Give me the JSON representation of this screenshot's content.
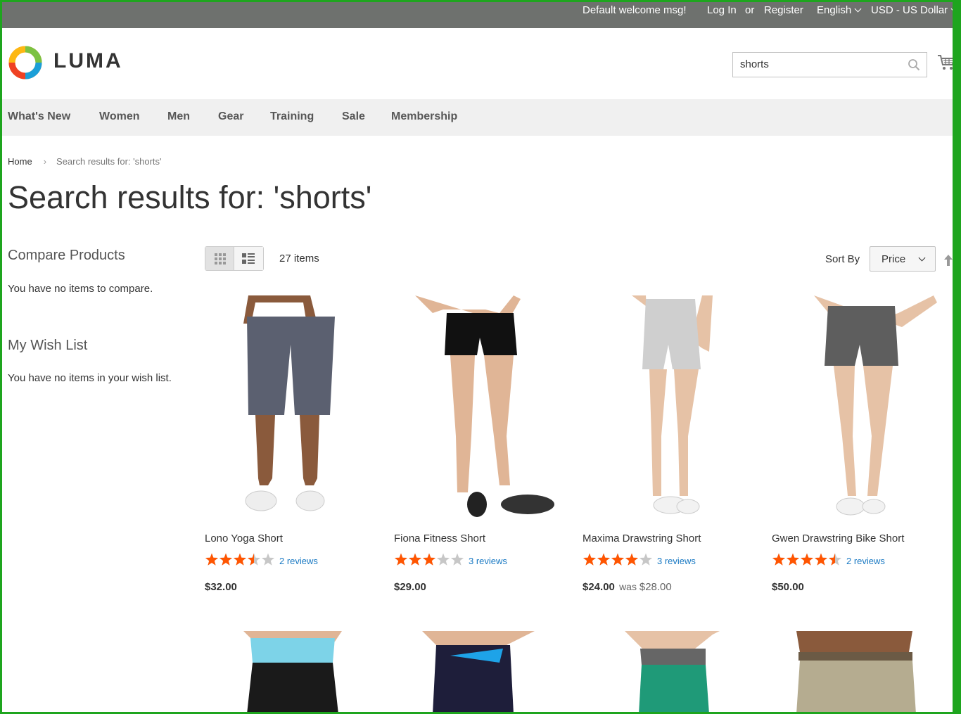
{
  "topbar": {
    "welcome": "Default welcome msg!",
    "login": "Log In",
    "or": "or",
    "register": "Register",
    "language": "English",
    "currency": "USD - US Dollar"
  },
  "header": {
    "logo_text": "LUMA",
    "search_value": "shorts"
  },
  "nav": {
    "items": [
      "What's New",
      "Women",
      "Men",
      "Gear",
      "Training",
      "Sale",
      "Membership"
    ]
  },
  "breadcrumb": {
    "home": "Home",
    "current": "Search results for: 'shorts'"
  },
  "page": {
    "title": "Search results for: 'shorts'"
  },
  "sidebar": {
    "compare_title": "Compare Products",
    "compare_text": "You have no items to compare.",
    "wishlist_title": "My Wish List",
    "wishlist_text": "You have no items in your wish list."
  },
  "toolbar": {
    "amount": "27 items",
    "sort_label": "Sort By",
    "sort_value": "Price"
  },
  "colors": {
    "accent_star": "#ff5501",
    "link": "#1979c3",
    "topbar": "#6e716e",
    "frame": "#1ea51e"
  },
  "products": [
    {
      "name": "Lono Yoga Short",
      "rating_stars": 3.5,
      "reviews": "2 reviews",
      "price": "$32.00",
      "was_label": "",
      "old_price": ""
    },
    {
      "name": "Fiona Fitness Short",
      "rating_stars": 3,
      "reviews": "3 reviews",
      "price": "$29.00",
      "was_label": "",
      "old_price": ""
    },
    {
      "name": "Maxima Drawstring Short",
      "rating_stars": 4,
      "reviews": "3 reviews",
      "price": "$24.00",
      "was_label": "was",
      "old_price": "$28.00"
    },
    {
      "name": "Gwen Drawstring Bike Short",
      "rating_stars": 4.5,
      "reviews": "2 reviews",
      "price": "$50.00",
      "was_label": "",
      "old_price": ""
    }
  ]
}
